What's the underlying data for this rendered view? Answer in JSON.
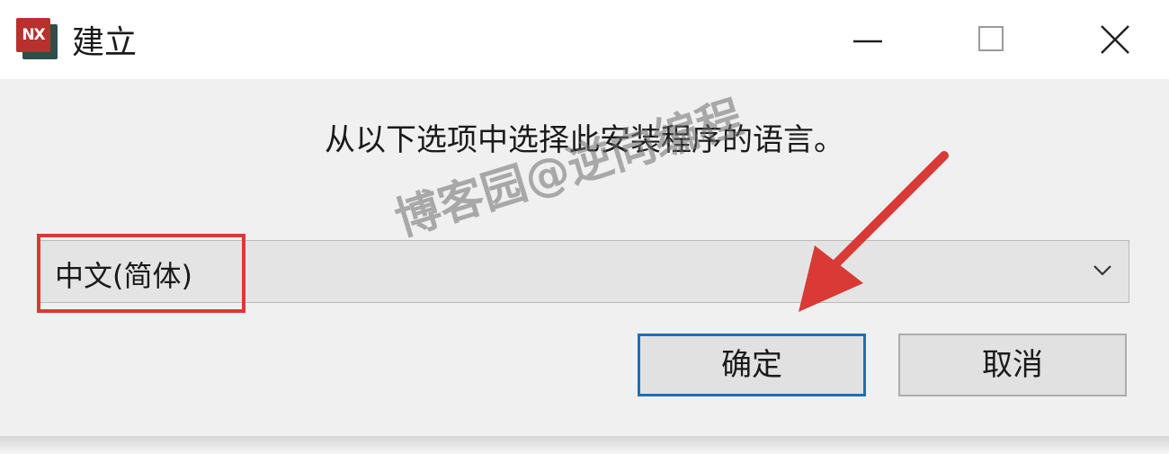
{
  "window": {
    "title": "建立",
    "app_icon_text": "NX",
    "controls": {
      "minimize_icon": "minimize-icon",
      "maximize_icon": "maximize-icon",
      "close_icon": "close-icon"
    }
  },
  "dialog": {
    "prompt": "从以下选项中选择此安装程序的语言。",
    "language_select": {
      "selected": "中文(简体)",
      "chevron_icon": "chevron-down-icon"
    },
    "buttons": {
      "ok": "确定",
      "cancel": "取消"
    }
  },
  "overlay": {
    "watermark": "博客园@逆向编程",
    "highlight_color": "#d93a36",
    "arrow_color": "#d93a36",
    "focus_color": "#1f6fb4"
  }
}
